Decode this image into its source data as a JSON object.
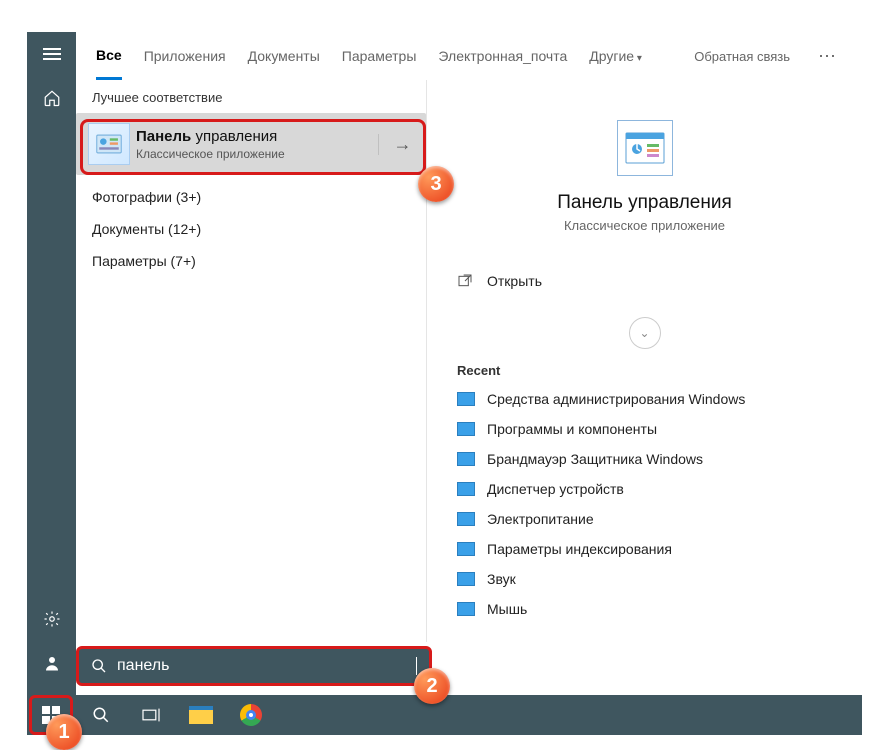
{
  "tabs": {
    "all": "Все",
    "apps": "Приложения",
    "docs": "Документы",
    "params": "Параметры",
    "email": "Электронная_почта",
    "more": "Другие",
    "feedback": "Обратная связь"
  },
  "results": {
    "best_header": "Лучшее соответствие",
    "best_title_bold": "Панель",
    "best_title_rest": " управления",
    "best_sub": "Классическое приложение",
    "cats": {
      "photos": "Фотографии (3+)",
      "documents": "Документы (12+)",
      "params": "Параметры (7+)"
    }
  },
  "detail": {
    "title": "Панель управления",
    "sub": "Классическое приложение",
    "open": "Открыть",
    "recent_header": "Recent",
    "recent": [
      "Средства администрирования Windows",
      "Программы и компоненты",
      "Брандмауэр Защитника Windows",
      "Диспетчер устройств",
      "Электропитание",
      "Параметры индексирования",
      "Звук",
      "Мышь"
    ]
  },
  "search": {
    "value": "панель"
  },
  "badges": {
    "b1": "1",
    "b2": "2",
    "b3": "3"
  }
}
